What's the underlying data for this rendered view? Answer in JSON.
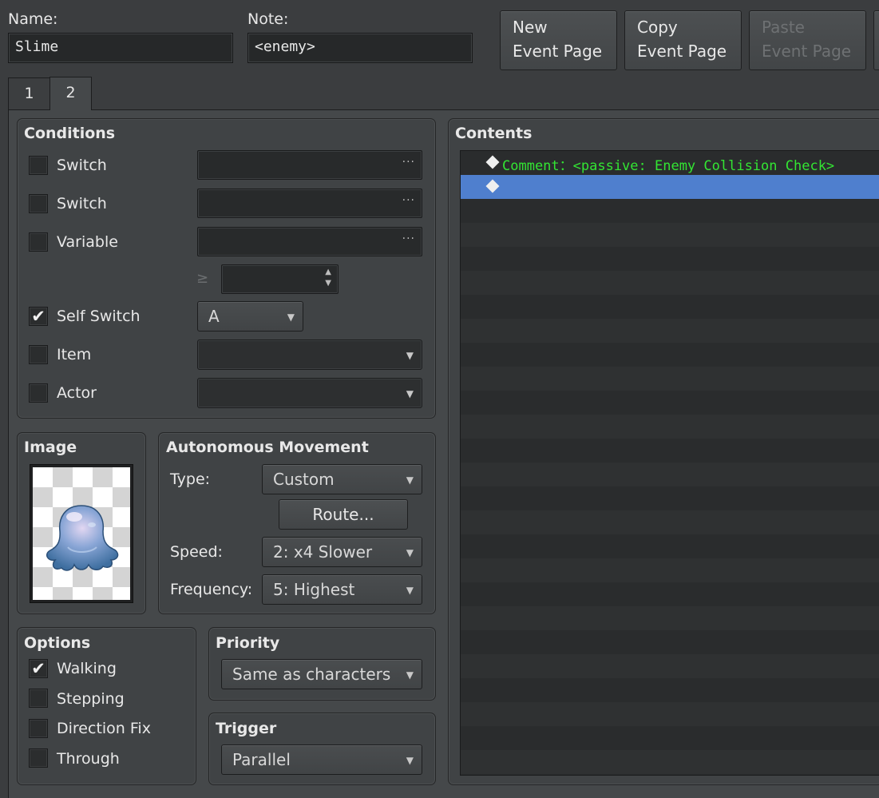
{
  "header": {
    "name_label": "Name:",
    "name_value": "Slime",
    "note_label": "Note:",
    "note_value": "<enemy>",
    "buttons": [
      {
        "line1": "New",
        "line2": "Event Page",
        "enabled": true
      },
      {
        "line1": "Copy",
        "line2": "Event Page",
        "enabled": true
      },
      {
        "line1": "Paste",
        "line2": "Event Page",
        "enabled": false
      }
    ]
  },
  "tabs": [
    {
      "label": "1",
      "active": false
    },
    {
      "label": "2",
      "active": true
    }
  ],
  "conditions": {
    "title": "Conditions",
    "switch1": {
      "label": "Switch",
      "checked": false,
      "value": "",
      "icon": "ellipsis-icon"
    },
    "switch2": {
      "label": "Switch",
      "checked": false,
      "value": "",
      "icon": "ellipsis-icon"
    },
    "variable": {
      "label": "Variable",
      "checked": false,
      "value": "",
      "compare": "≥",
      "amount": ""
    },
    "self_switch": {
      "label": "Self Switch",
      "checked": true,
      "value": "A"
    },
    "item": {
      "label": "Item",
      "checked": false,
      "value": ""
    },
    "actor": {
      "label": "Actor",
      "checked": false,
      "value": ""
    }
  },
  "image": {
    "title": "Image",
    "sprite": "slime-sprite"
  },
  "movement": {
    "title": "Autonomous Movement",
    "type_label": "Type:",
    "type_value": "Custom",
    "route_button": "Route...",
    "speed_label": "Speed:",
    "speed_value": "2: x4 Slower",
    "frequency_label": "Frequency:",
    "frequency_value": "5: Highest"
  },
  "options": {
    "title": "Options",
    "items": [
      {
        "label": "Walking",
        "checked": true
      },
      {
        "label": "Stepping",
        "checked": false
      },
      {
        "label": "Direction Fix",
        "checked": false
      },
      {
        "label": "Through",
        "checked": false
      }
    ]
  },
  "priority": {
    "title": "Priority",
    "value": "Same as characters"
  },
  "trigger": {
    "title": "Trigger",
    "value": "Parallel"
  },
  "contents": {
    "title": "Contents",
    "commands": [
      {
        "text": "Comment：<passive: Enemy Collision Check>",
        "selected": false
      },
      {
        "text": "",
        "selected": true
      }
    ]
  },
  "colors": {
    "comment_text": "#33e533",
    "selection": "#4f7fce",
    "background": "#3b3d3f"
  }
}
